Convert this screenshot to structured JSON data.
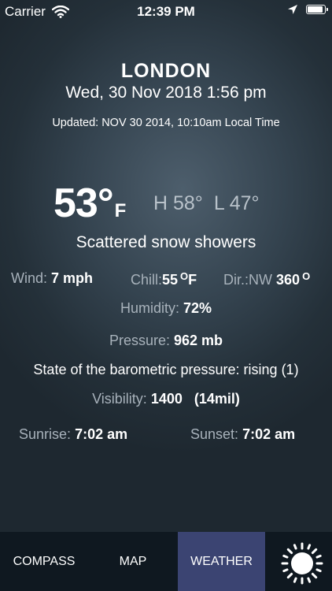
{
  "status_bar": {
    "carrier": "Carrier",
    "time": "12:39 PM",
    "battery_level": 0.92,
    "icons": [
      "wifi-icon",
      "location-arrow-icon",
      "battery-icon"
    ]
  },
  "header": {
    "city": "LONDON",
    "datetime": "Wed, 30 Nov 2018 1:56 pm",
    "updated": "Updated: NOV 30 2014, 10:10am Local Time"
  },
  "current": {
    "temperature": "53°",
    "unit": "F",
    "high": "H 58°",
    "low": "L 47°",
    "condition": "Scattered snow showers"
  },
  "details": {
    "wind_label": "Wind:",
    "wind_value": "7 mph",
    "chill_label": "Chill:",
    "chill_value": "55",
    "chill_deg": "O",
    "chill_unit": "F",
    "dir_label": "Dir.:",
    "dir_value_dir": "NW",
    "dir_value_deg": "360",
    "dir_deg": "O",
    "humidity_label": "Humidity:",
    "humidity_value": "72%",
    "pressure_label": "Pressure:",
    "pressure_value": "962 mb",
    "barometric_text": "State of the barometric pressure: rising (1)",
    "visibility_label": "Visibility:",
    "visibility_value": "1400   (14mil)",
    "sunrise_label": "Sunrise:",
    "sunrise_value": "7:02 am",
    "sunset_label": "Sunset:",
    "sunset_value": "7:02 am"
  },
  "tab_bar": {
    "tabs": [
      {
        "label": "COMPASS",
        "active": false
      },
      {
        "label": "MAP",
        "active": false
      },
      {
        "label": "WEATHER",
        "active": true
      }
    ],
    "icon": "sun-icon"
  },
  "colors": {
    "active_tab": "#3b4472",
    "tab_bar_bg": "#0f1820",
    "label_gray": "#a8b2bb"
  }
}
